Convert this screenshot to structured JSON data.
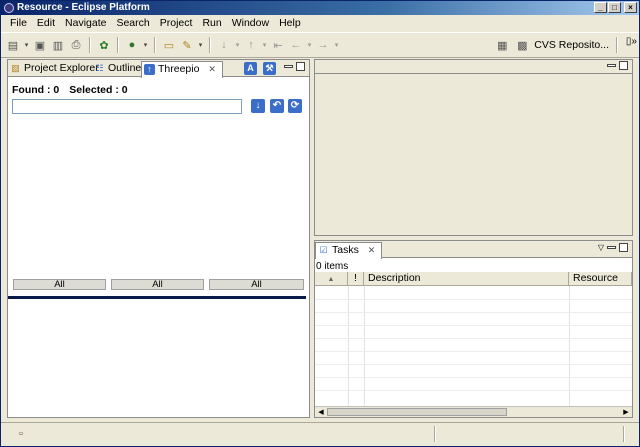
{
  "window": {
    "title": "Resource - Eclipse Platform"
  },
  "menu": [
    "File",
    "Edit",
    "Navigate",
    "Search",
    "Project",
    "Run",
    "Window",
    "Help"
  ],
  "perspective": {
    "label": "CVS Reposito..."
  },
  "left_view": {
    "tabs": [
      {
        "label": "Project Explorer",
        "icon": "project-explorer-icon"
      },
      {
        "label": "Outline",
        "icon": "outline-icon"
      },
      {
        "label": "Threepio",
        "icon": "threepio-icon",
        "active": true
      }
    ],
    "found_label": "Found : 0",
    "selected_label": "Selected : 0",
    "search_value": "",
    "all_buttons": [
      "All",
      "All",
      "All"
    ]
  },
  "tasks_view": {
    "tab_label": "Tasks",
    "count_label": "0 items",
    "columns": [
      "",
      "!",
      "Description",
      "Resource"
    ]
  },
  "colors": {
    "title_bar": "#0a246a",
    "chrome": "#ece9d8",
    "action_blue": "#3a6ec8"
  }
}
